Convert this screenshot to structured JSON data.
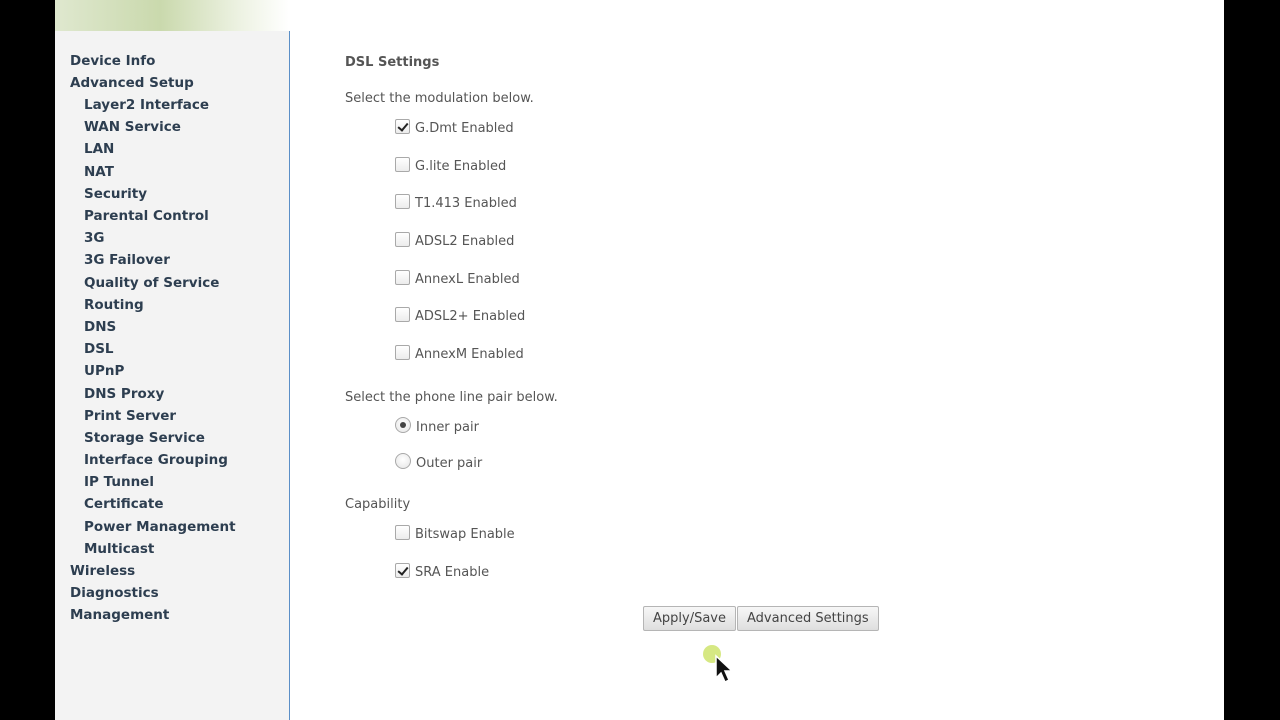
{
  "sidebar": {
    "items": [
      {
        "label": "Device Info",
        "level": 1
      },
      {
        "label": "Advanced Setup",
        "level": 1
      },
      {
        "label": "Layer2 Interface",
        "level": 2
      },
      {
        "label": "WAN Service",
        "level": 2
      },
      {
        "label": "LAN",
        "level": 2
      },
      {
        "label": "NAT",
        "level": 2
      },
      {
        "label": "Security",
        "level": 2
      },
      {
        "label": "Parental Control",
        "level": 2
      },
      {
        "label": "3G",
        "level": 2
      },
      {
        "label": "3G Failover",
        "level": 2
      },
      {
        "label": "Quality of Service",
        "level": 2
      },
      {
        "label": "Routing",
        "level": 2
      },
      {
        "label": "DNS",
        "level": 2
      },
      {
        "label": "DSL",
        "level": 2
      },
      {
        "label": "UPnP",
        "level": 2
      },
      {
        "label": "DNS Proxy",
        "level": 2
      },
      {
        "label": "Print Server",
        "level": 2
      },
      {
        "label": "Storage Service",
        "level": 2
      },
      {
        "label": "Interface Grouping",
        "level": 2
      },
      {
        "label": "IP Tunnel",
        "level": 2
      },
      {
        "label": "Certificate",
        "level": 2
      },
      {
        "label": "Power Management",
        "level": 2
      },
      {
        "label": "Multicast",
        "level": 2
      },
      {
        "label": "Wireless",
        "level": 1
      },
      {
        "label": "Diagnostics",
        "level": 1
      },
      {
        "label": "Management",
        "level": 1
      }
    ]
  },
  "main": {
    "title": "DSL Settings",
    "modulation": {
      "prompt": "Select the modulation below.",
      "options": [
        {
          "label": "G.Dmt Enabled",
          "checked": true
        },
        {
          "label": "G.lite Enabled",
          "checked": false
        },
        {
          "label": "T1.413 Enabled",
          "checked": false
        },
        {
          "label": "ADSL2 Enabled",
          "checked": false
        },
        {
          "label": "AnnexL Enabled",
          "checked": false
        },
        {
          "label": "ADSL2+ Enabled",
          "checked": false
        },
        {
          "label": "AnnexM Enabled",
          "checked": false
        }
      ]
    },
    "phone_line": {
      "prompt": "Select the phone line pair below.",
      "options": [
        {
          "label": "Inner pair",
          "selected": true
        },
        {
          "label": "Outer pair",
          "selected": false
        }
      ]
    },
    "capability": {
      "prompt": "Capability",
      "options": [
        {
          "label": "Bitswap Enable",
          "checked": false
        },
        {
          "label": "SRA Enable",
          "checked": true
        }
      ]
    },
    "buttons": {
      "apply_save": "Apply/Save",
      "advanced_settings": "Advanced Settings"
    }
  },
  "colors": {
    "sidebar_text": "#2d3e50",
    "body_text": "#555555",
    "sidebar_border": "#5b8fc7",
    "banner_green": "#cad9ad"
  }
}
